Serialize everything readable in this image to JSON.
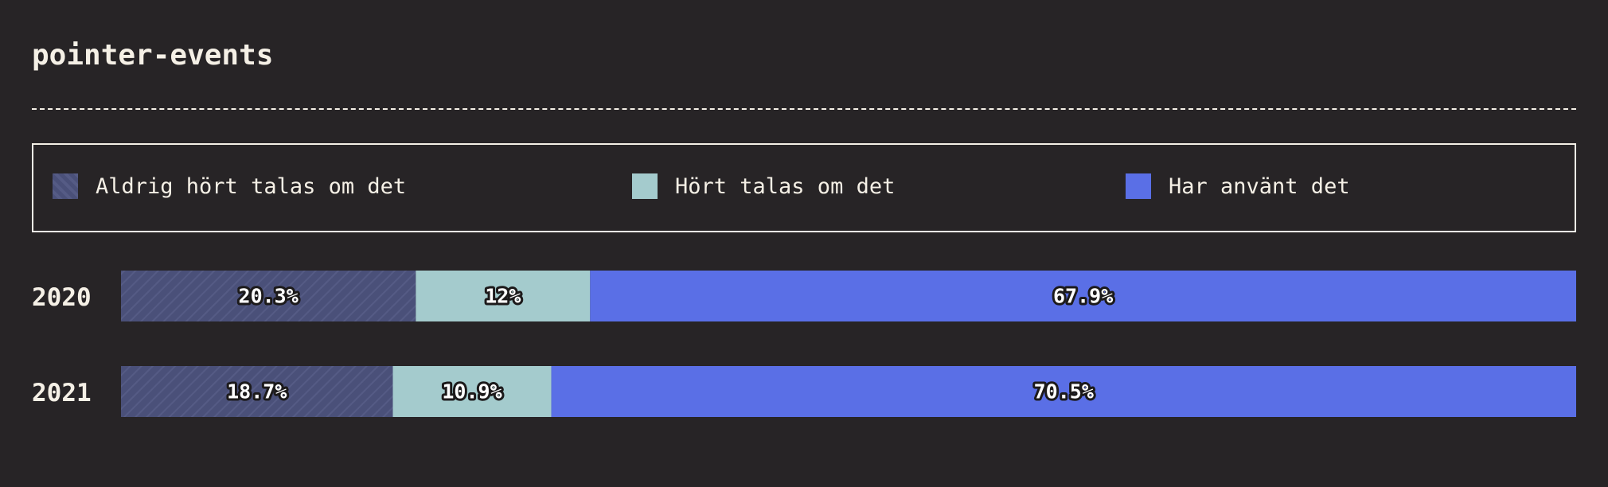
{
  "title": "pointer-events",
  "colors": {
    "background": "#272426",
    "text": "#f5f0e6",
    "never_heard": "#4a5079",
    "heard": "#a4cbcd",
    "used": "#5a6fe6"
  },
  "legend": [
    {
      "label": "Aldrig hört talas om det",
      "color": "#4a5079",
      "pattern": "hatched"
    },
    {
      "label": "Hört talas om det",
      "color": "#a4cbcd"
    },
    {
      "label": "Har använt det",
      "color": "#5a6fe6"
    }
  ],
  "chart_data": {
    "type": "bar",
    "orientation": "horizontal",
    "stacked": true,
    "normalized": true,
    "title": "pointer-events",
    "categories": [
      "2020",
      "2021"
    ],
    "series": [
      {
        "name": "Aldrig hört talas om det",
        "values": [
          20.3,
          18.7
        ],
        "labels": [
          "20.3%",
          "18.7%"
        ]
      },
      {
        "name": "Hört talas om det",
        "values": [
          12,
          10.9
        ],
        "labels": [
          "12%",
          "10.9%"
        ]
      },
      {
        "name": "Har använt det",
        "values": [
          67.9,
          70.5
        ],
        "labels": [
          "67.9%",
          "70.5%"
        ]
      }
    ],
    "xlim": [
      0,
      100
    ],
    "grid": false,
    "legend_position": "top"
  }
}
